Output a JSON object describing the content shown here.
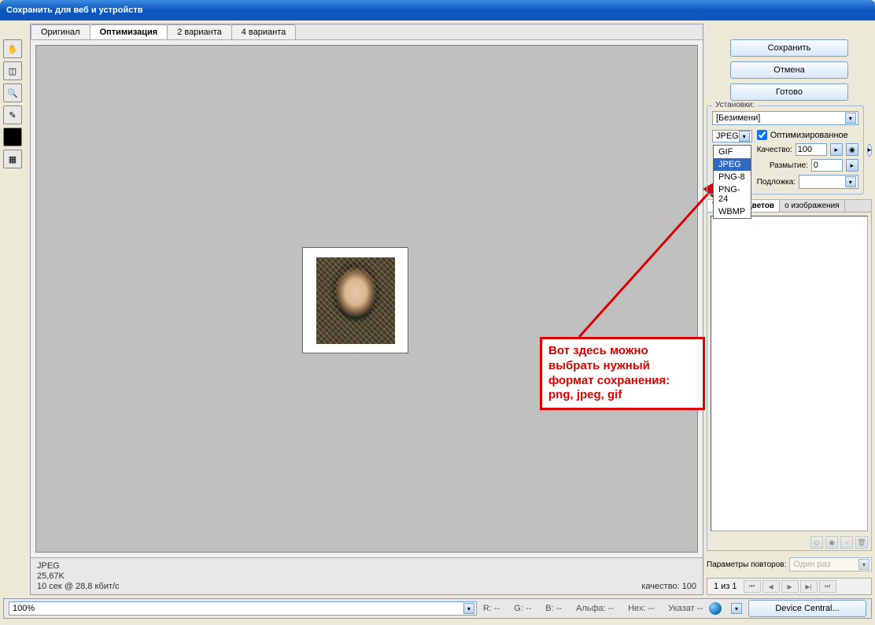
{
  "window": {
    "title": "Сохранить для веб и устройств"
  },
  "tabs": [
    "Оригинал",
    "Оптимизация",
    "2 варианта",
    "4 варианта"
  ],
  "active_tab": 1,
  "tools": [
    "hand",
    "slice",
    "zoom",
    "eyedropper",
    "color",
    "toggle"
  ],
  "info": {
    "format": "JPEG",
    "size": "25,67K",
    "speed": "10 сек @ 28,8 кбит/с",
    "quality_label": "качество: 100"
  },
  "buttons": {
    "save": "Сохранить",
    "cancel": "Отмена",
    "done": "Готово"
  },
  "preset": {
    "label": "Установки:",
    "value": "[Безимени]"
  },
  "format_select": {
    "value": "JPEG",
    "options": [
      "GIF",
      "JPEG",
      "PNG-8",
      "PNG-24",
      "WBMP"
    ]
  },
  "optimized": {
    "label": "Оптимизированное",
    "checked": true
  },
  "quality_row": {
    "label": "Качество:",
    "value": "100"
  },
  "blur_row": {
    "label": "Размытие:",
    "value": "0"
  },
  "matte_row": {
    "label": "Подложка:"
  },
  "color_table": {
    "tab1": "Таблица цветов",
    "tab2": "о изображения"
  },
  "repeat": {
    "label": "Параметры повторов:",
    "value": "Один раз"
  },
  "frame_counter": "1 из 1",
  "zoom": "100%",
  "readouts": {
    "r": "R:   --",
    "g": "G:   --",
    "b": "B:   --",
    "alpha": "Альфа:   --",
    "hex": "Hex:   --",
    "index": "Указат   --"
  },
  "device_central": "Device Central...",
  "annotation": "Вот здесь можно выбрать нужный формат сохранения: png, jpeg, gif"
}
